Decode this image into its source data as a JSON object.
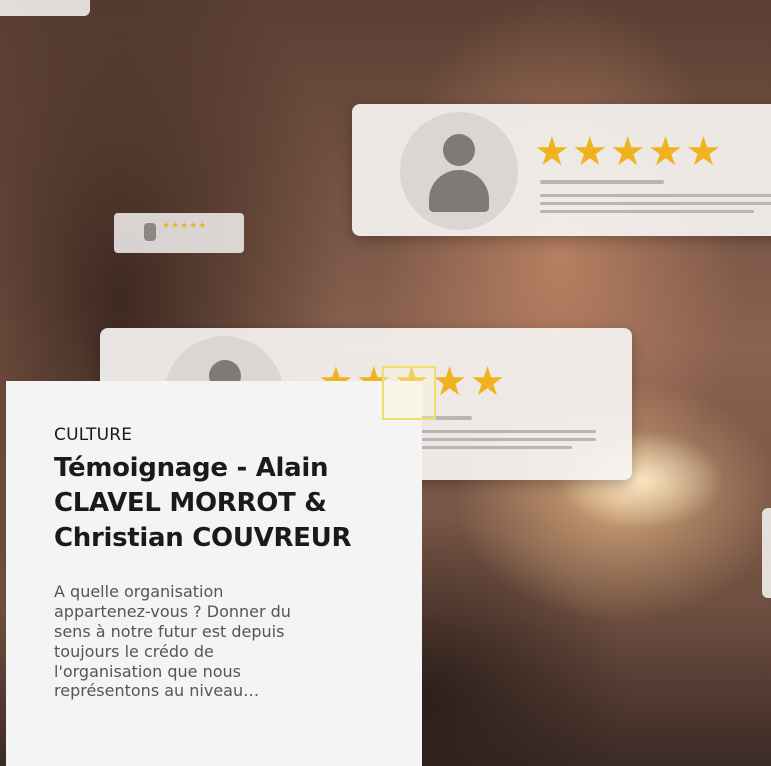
{
  "article": {
    "category": "CULTURE",
    "title": "Témoignage - Alain CLAVEL MORROT & Christian COUVREUR",
    "excerpt": "A quelle organisation appartenez-vous ? Donner du sens à notre futur est depuis toujours le crédo de l'organisation que nous représentons au niveau…"
  },
  "image": {
    "rating_cards": [
      {
        "stars": "★★★★★",
        "rating": 5
      },
      {
        "stars": "★★★★★",
        "rating": 5
      }
    ],
    "star_color": "#f0b31f"
  },
  "colors": {
    "panel_background": "#f4f4f4",
    "title_color": "#1a1a1a",
    "excerpt_color": "#555555"
  }
}
